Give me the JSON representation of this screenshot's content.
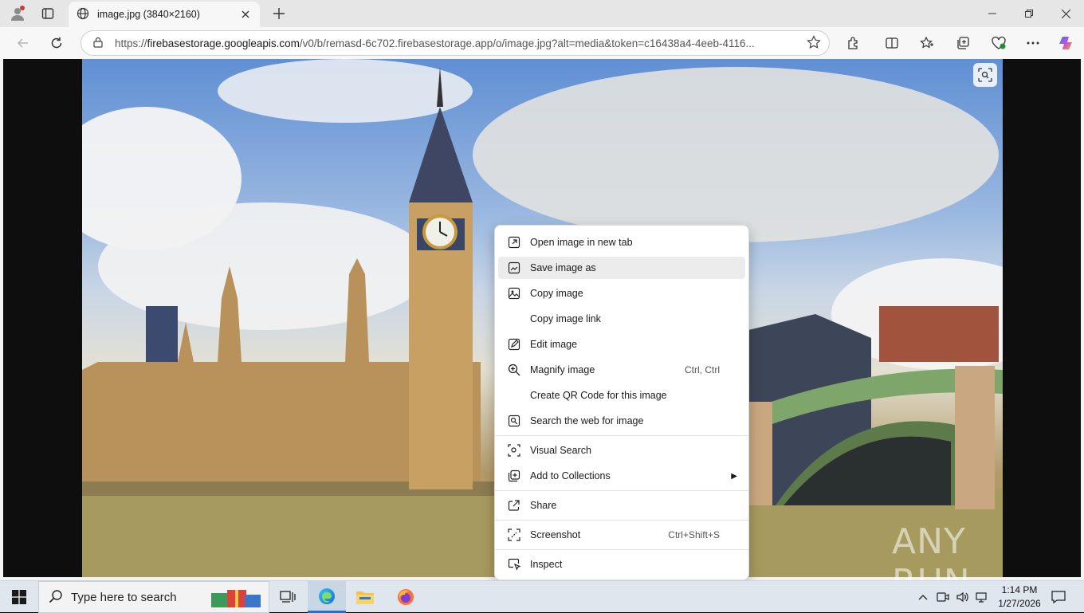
{
  "tab": {
    "title": "image.jpg (3840×2160)"
  },
  "address": {
    "scheme": "https://",
    "host": "firebasestorage.googleapis.com",
    "path": "/v0/b/remasd-6c702.firebasestorage.app/o/image.jpg?alt=media&token=c16438a4-4eeb-4116..."
  },
  "context_menu": {
    "items": [
      {
        "label": "Open image in new tab",
        "icon": "open-new-tab-icon"
      },
      {
        "label": "Save image as",
        "icon": "save-image-icon"
      },
      {
        "label": "Copy image",
        "icon": "copy-image-icon"
      },
      {
        "label": "Copy image link",
        "icon": ""
      },
      {
        "label": "Edit image",
        "icon": "edit-image-icon"
      },
      {
        "label": "Magnify image",
        "icon": "magnify-icon",
        "shortcut": "Ctrl, Ctrl"
      },
      {
        "label": "Create QR Code for this image",
        "icon": ""
      },
      {
        "label": "Search the web for image",
        "icon": "search-web-icon"
      },
      {
        "label": "Visual Search",
        "icon": "visual-search-icon"
      },
      {
        "label": "Add to Collections",
        "icon": "collections-icon"
      },
      {
        "label": "Share",
        "icon": "share-icon"
      },
      {
        "label": "Screenshot",
        "icon": "screenshot-icon",
        "shortcut": "Ctrl+Shift+S"
      },
      {
        "label": "Inspect",
        "icon": "inspect-icon"
      }
    ]
  },
  "watermark": {
    "text": "ANY RUN"
  },
  "taskbar": {
    "search_placeholder": "Type here to search",
    "time": "1:14 PM",
    "date": "1/27/2026"
  },
  "colors": {
    "accent": "#2a6fc0",
    "menu_highlight": "#ececec"
  }
}
